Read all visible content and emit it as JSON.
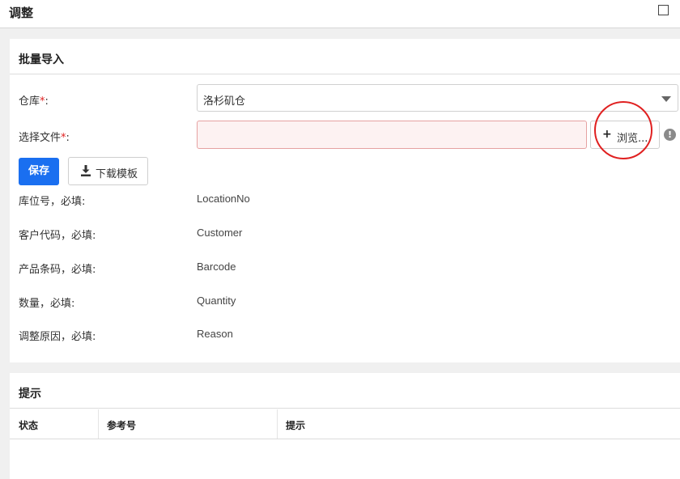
{
  "window": {
    "title": "调整"
  },
  "import_panel": {
    "title": "批量导入",
    "warehouse": {
      "label": "仓库",
      "required_mark": "*",
      "colon": ":",
      "selected": "洛杉矶仓"
    },
    "file": {
      "label": "选择文件",
      "required_mark": "*",
      "colon": ":",
      "value": "",
      "browse_label": "浏览...",
      "info_glyph": "!"
    },
    "save_label": "保存",
    "download_template_label": "下载模板",
    "fields": [
      {
        "label": "库位号，必填:",
        "column": "LocationNo"
      },
      {
        "label": "客户代码，必填:",
        "column": "Customer"
      },
      {
        "label": "产品条码，必填:",
        "column": "Barcode"
      },
      {
        "label": "数量，必填:",
        "column": "Quantity"
      },
      {
        "label": "调整原因，必填:",
        "column": "Reason"
      }
    ]
  },
  "hint_panel": {
    "title": "提示",
    "columns": [
      "状态",
      "参考号",
      "提示"
    ]
  },
  "colors": {
    "primary": "#1a6ff0",
    "required": "#e02020",
    "error_field_bg": "#fdf2f2",
    "annotation": "#e02020"
  }
}
